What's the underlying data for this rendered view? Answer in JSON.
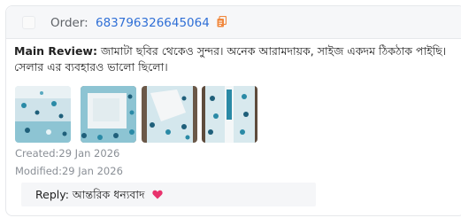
{
  "order": {
    "label": "Order:",
    "number": "683796326645064"
  },
  "review": {
    "label": "Main Review:",
    "text": "জামাটা ছবির থেকেও সুন্দর। অনেক আরামদায়ক, সাইজ একদম ঠিকঠাক পাইছি। সেলার এর ব্যবহারও ভালো ছিলো।"
  },
  "images": [
    {
      "icon": "photo-thumbnail"
    },
    {
      "icon": "photo-thumbnail"
    },
    {
      "icon": "photo-thumbnail"
    },
    {
      "icon": "photo-thumbnail"
    }
  ],
  "meta": {
    "created": "Created:29 Jan 2026",
    "modified": "Modified:29 Jan 2026"
  },
  "reply": {
    "label": "Reply:",
    "text": "আন্তরিক ধন্যবাদ"
  },
  "colors": {
    "order_link": "#2f6fd6",
    "copy_icon": "#f0883e",
    "heart": "#e8336d",
    "meta_text": "#8a8f96"
  }
}
